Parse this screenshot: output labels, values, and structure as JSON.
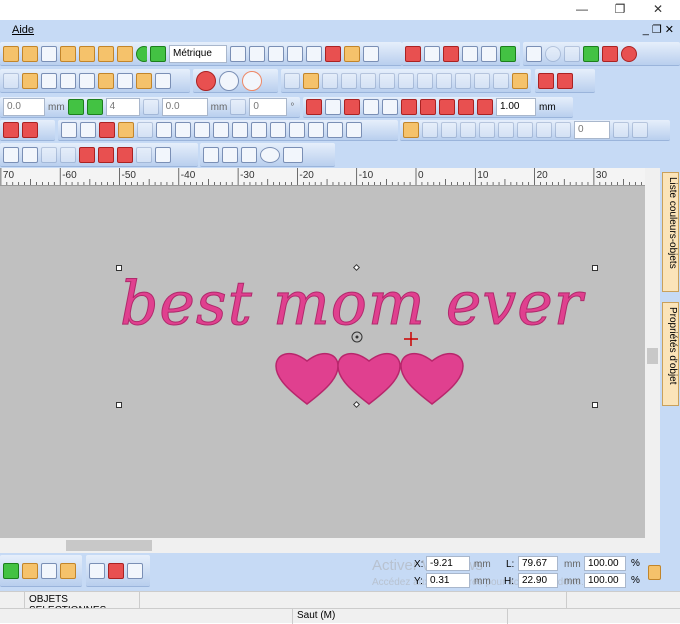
{
  "window": {
    "minimize": "—",
    "restore": "❐",
    "close": "✕"
  },
  "menu": {
    "items": [
      {
        "label": "Aide"
      }
    ],
    "mdi_controls": "_ ❐ ✕"
  },
  "toolbar": {
    "units_select": "Métrique",
    "row3": {
      "value1": "0.0",
      "unit1": "mm",
      "count": "4",
      "angle": "0.0",
      "unit2": "mm",
      "angle2": "0",
      "deg": "°",
      "width": "1.00",
      "unit3": "mm"
    },
    "row4": {
      "select_value": "0"
    }
  },
  "ruler": {
    "ticks": [
      "70",
      "-60",
      "-50",
      "-40",
      "-30",
      "-20",
      "-10",
      "0",
      "10",
      "20",
      "30"
    ]
  },
  "design": {
    "text": "best mom ever",
    "color": "#e0408f",
    "hearts": 3
  },
  "side_tabs": [
    "Liste couleurs-objets",
    "Propriétés d'objet"
  ],
  "position": {
    "x_label": "X:",
    "x": "-9.21",
    "y_label": "Y:",
    "y": "0.31",
    "l_label": "L:",
    "l": "79.67",
    "h_label": "H:",
    "h": "22.90",
    "unit": "mm",
    "scale_x": "100.00",
    "scale_y": "100.00",
    "pct": "%"
  },
  "watermark": {
    "line1": "Activer Windows",
    "line2": "Accédez aux paramètres pour activer Windows."
  },
  "status": {
    "selection": "OBJETS SELECTIONNES",
    "mode": "Saut (M)"
  }
}
